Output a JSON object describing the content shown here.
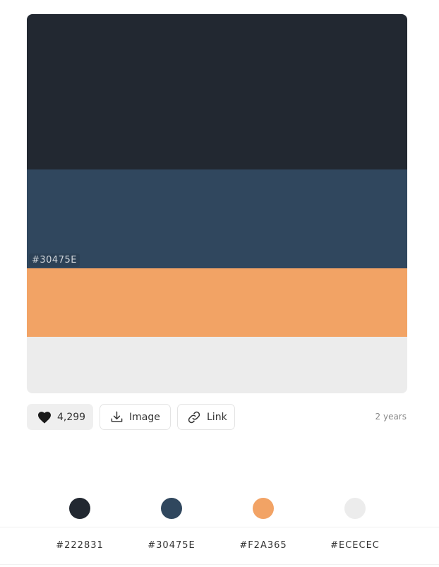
{
  "palette": {
    "colors": [
      {
        "hex": "#222831",
        "color": "#222831"
      },
      {
        "hex": "#30475E",
        "color": "#30475E"
      },
      {
        "hex": "#F2A365",
        "color": "#F2A365"
      },
      {
        "hex": "#ECECEC",
        "color": "#ECECEC"
      }
    ],
    "hovered_hex": "#30475E"
  },
  "actions": {
    "likes": "4,299",
    "image_label": "Image",
    "link_label": "Link",
    "time_ago": "2 years"
  },
  "icons": {
    "like": "heart-icon",
    "image": "download-icon",
    "link": "link-icon"
  }
}
